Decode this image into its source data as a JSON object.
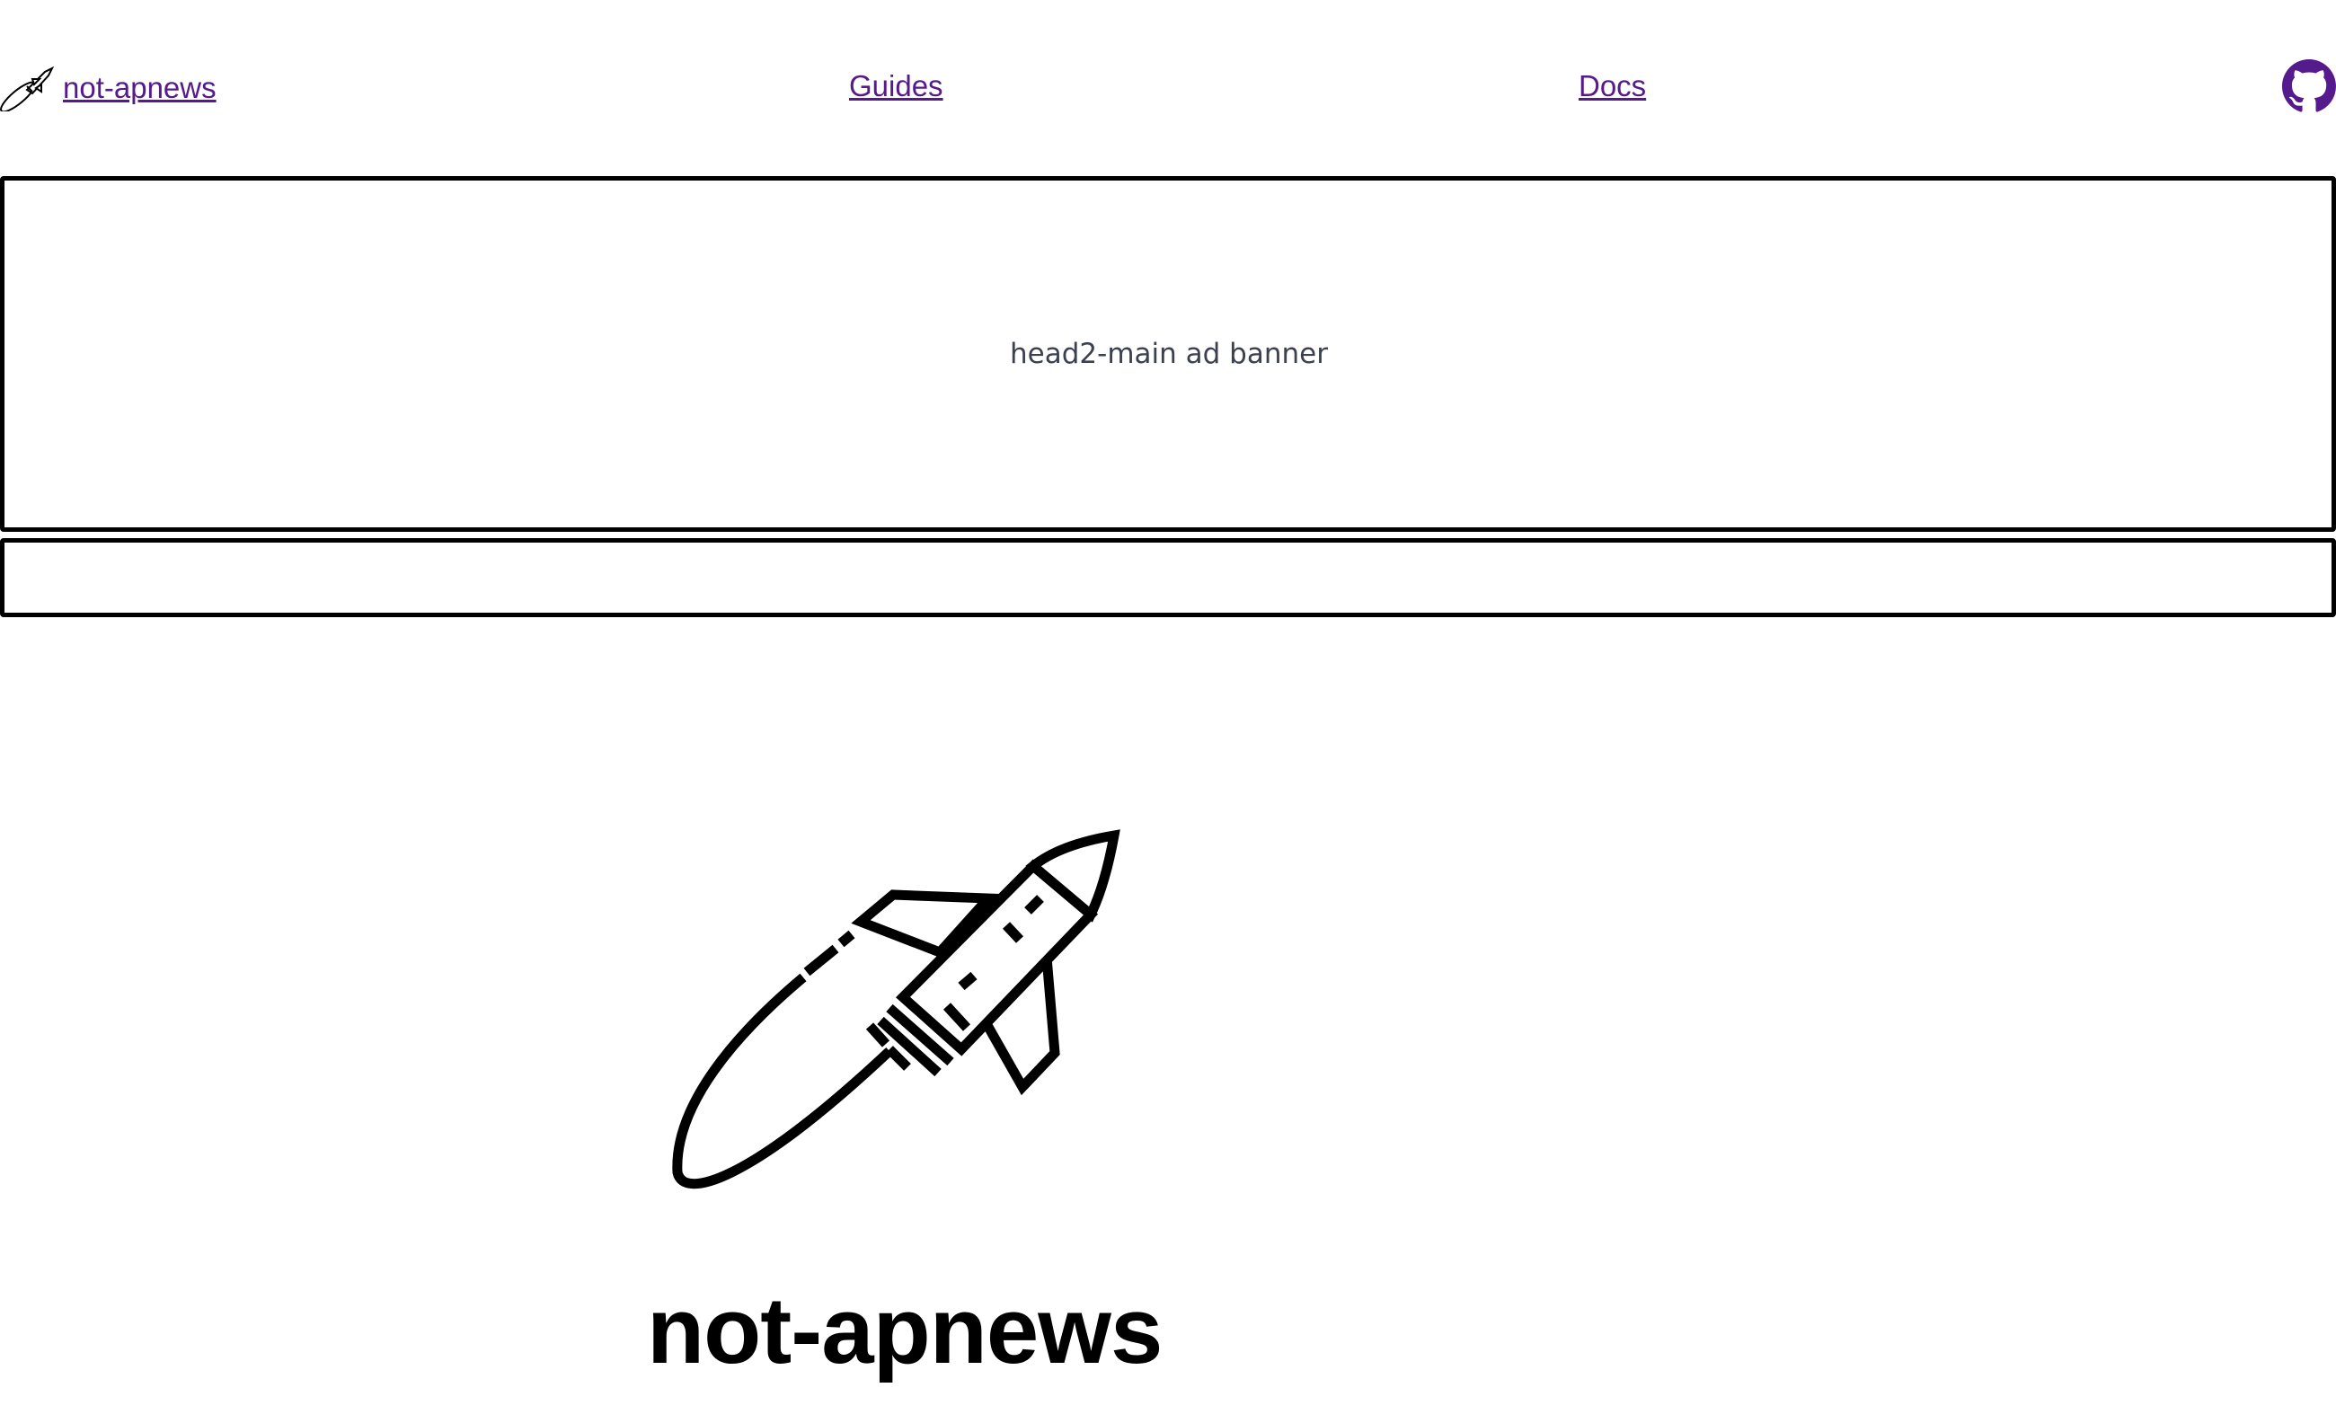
{
  "header": {
    "brand": {
      "label": " not-apnews",
      "icon": "rocket-icon"
    },
    "nav": {
      "guides_label": "Guides",
      "docs_label": "Docs"
    },
    "github": {
      "icon": "github-icon"
    },
    "link_color": "#551a8b"
  },
  "ads": {
    "main_banner_text": "head2-main ad banner"
  },
  "hero": {
    "title": "not-apnews",
    "icon": "rocket-icon"
  }
}
